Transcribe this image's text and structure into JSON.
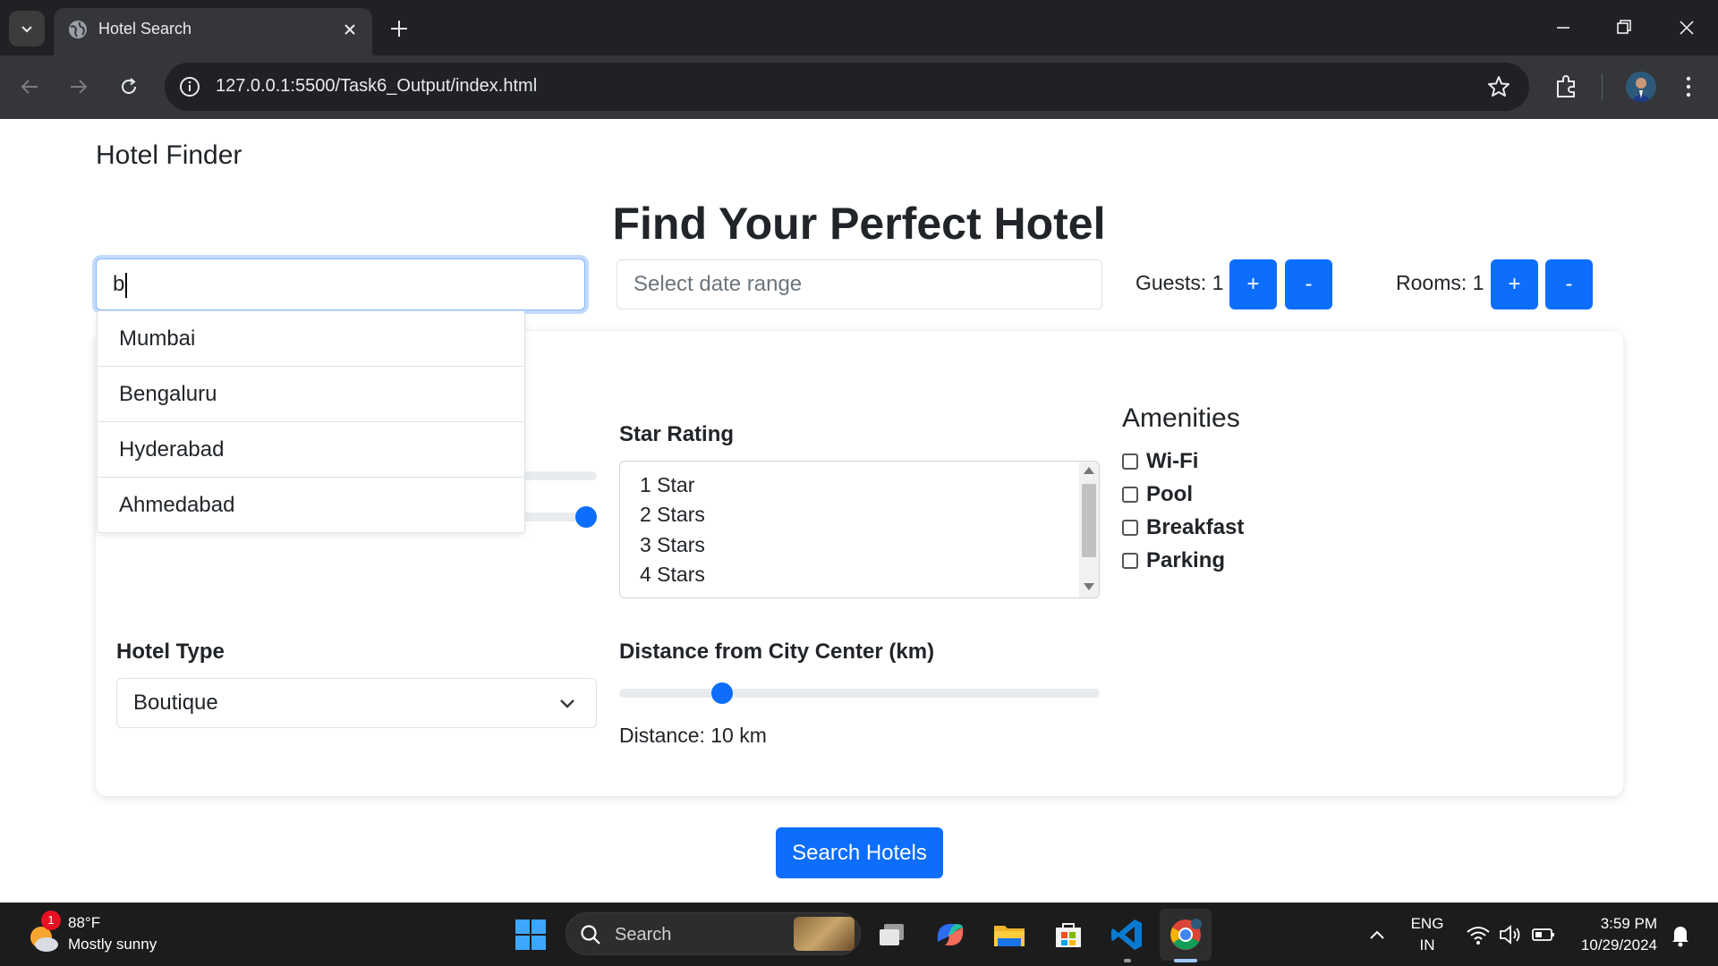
{
  "browser": {
    "tab_title": "Hotel Search",
    "url": "127.0.0.1:5500/Task6_Output/index.html"
  },
  "page": {
    "brand": "Hotel Finder",
    "headline": "Find Your Perfect Hotel",
    "location_value": "b",
    "date_placeholder": "Select date range",
    "guests_label": "Guests: 1",
    "rooms_label": "Rooms: 1",
    "plus_label": "+",
    "minus_label": "-",
    "suggestions": [
      "Mumbai",
      "Bengaluru",
      "Hyderabad",
      "Ahmedabad"
    ],
    "star_rating": {
      "label": "Star Rating",
      "options": [
        "1 Star",
        "2 Stars",
        "3 Stars",
        "4 Stars"
      ]
    },
    "amenities": {
      "title": "Amenities",
      "items": [
        "Wi-Fi",
        "Pool",
        "Breakfast",
        "Parking"
      ]
    },
    "hotel_type": {
      "label": "Hotel Type",
      "selected": "Boutique"
    },
    "distance": {
      "label": "Distance from City Center (km)",
      "readout": "Distance: 10 km",
      "slider_fraction": 0.2
    },
    "price_slider_fraction": 1.0,
    "search_button": "Search Hotels"
  },
  "taskbar": {
    "weather_temp": "88°F",
    "weather_desc": "Mostly sunny",
    "weather_badge": "1",
    "search_label": "Search",
    "lang_top": "ENG",
    "lang_bottom": "IN",
    "time": "3:59 PM",
    "date": "10/29/2024"
  },
  "colors": {
    "primary": "#0d6efd",
    "chrome_dark": "#202124",
    "chrome_toolbar": "#35363a",
    "taskbar": "#1c1c1c"
  }
}
